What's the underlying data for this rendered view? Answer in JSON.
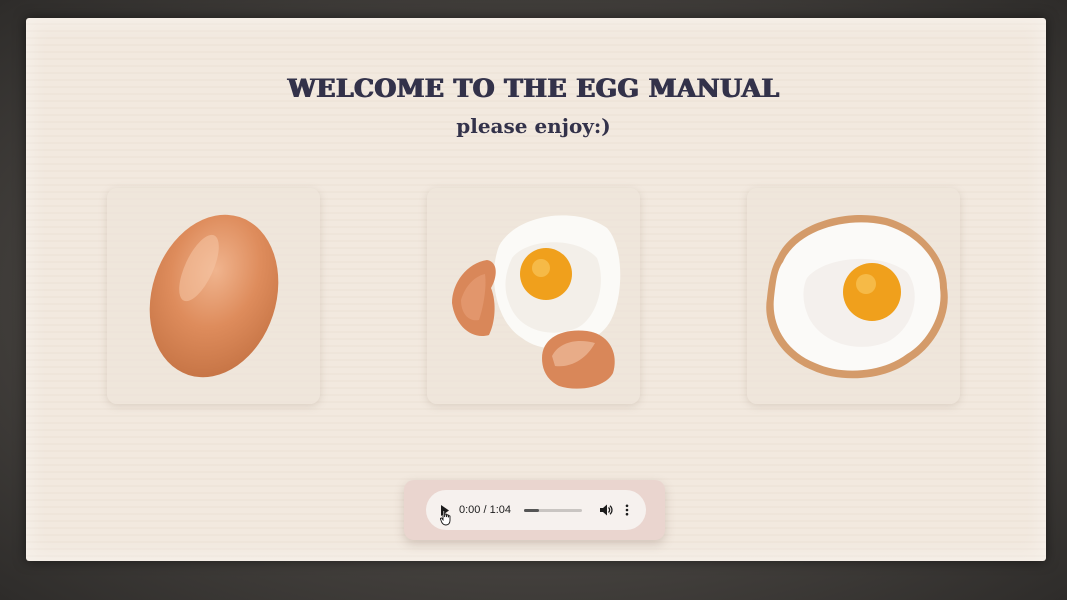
{
  "header": {
    "title": "WELCOME TO THE EGG MANUAL",
    "subtitle": "please enjoy:)"
  },
  "cards": [
    {
      "image": "whole-brown-egg"
    },
    {
      "image": "cracked-egg-with-yolk"
    },
    {
      "image": "fried-egg"
    }
  ],
  "audio_player": {
    "time_display": "0:00 / 1:04",
    "current_time": "0:00",
    "duration": "1:04",
    "progress_fraction": 0.25,
    "play_icon": "play-icon",
    "volume_icon": "volume-icon",
    "menu_icon": "more-vert-icon"
  },
  "colors": {
    "paper": "#f2e9df",
    "title": "#33324a",
    "egg_shell": "#d9875a",
    "yolk": "#f2a21e",
    "player_frame": "#ead5cf"
  }
}
